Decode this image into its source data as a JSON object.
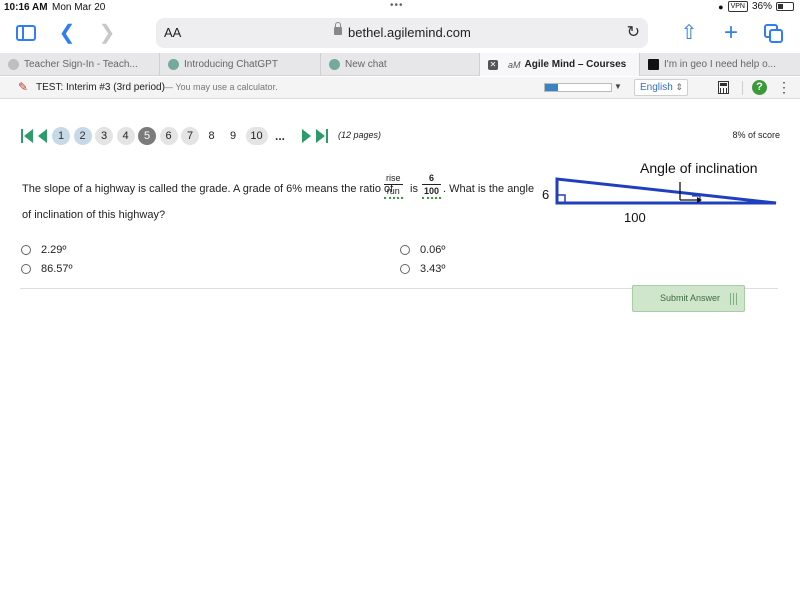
{
  "status": {
    "time": "10:16 AM",
    "date": "Mon Mar 20",
    "vpn": "VPN",
    "battery": "36%"
  },
  "browser": {
    "aa_label": "AA",
    "url": "bethel.agilemind.com",
    "accent_color": "#2f7ef5"
  },
  "tabs": [
    {
      "label": "Teacher Sign-In - Teach...",
      "icon": "teacher-favicon"
    },
    {
      "label": "Introducing ChatGPT",
      "icon": "chatgpt-favicon"
    },
    {
      "label": "New chat",
      "icon": "chatgpt-favicon"
    },
    {
      "label": "Agile Mind – Courses",
      "icon": "agilemind-favicon",
      "prefix": "aM",
      "active": true
    },
    {
      "label": "I'm in geo I need help o...",
      "icon": "bookmark-favicon"
    }
  ],
  "testbar": {
    "title": "TEST: Interim #3 (3rd period)",
    "note": "— You may use a calculator.",
    "progress_fraction": 0.2,
    "language": "English"
  },
  "pager": {
    "pages": [
      {
        "n": "1",
        "state": "answered"
      },
      {
        "n": "2",
        "state": "answered"
      },
      {
        "n": "3",
        "state": "visited"
      },
      {
        "n": "4",
        "state": "visited"
      },
      {
        "n": "5",
        "state": "current"
      },
      {
        "n": "6",
        "state": "visited"
      },
      {
        "n": "7",
        "state": "visited"
      },
      {
        "n": "8",
        "state": "plain"
      },
      {
        "n": "9",
        "state": "plain"
      },
      {
        "n": "10",
        "state": "visited"
      }
    ],
    "ellipsis": "...",
    "count": "(12 pages)",
    "score": "8% of score"
  },
  "question": {
    "part1": "The slope of a highway is called the grade. A grade of 6% means the ratio of",
    "frac1_num": "rise",
    "frac1_den": "run",
    "is_word": "is",
    "frac2_num": "6",
    "frac2_den": "100",
    "part2": ". What is the angle",
    "line2": "of inclination of this highway?"
  },
  "diagram": {
    "title": "Angle of inclination",
    "rise": "6",
    "run": "100"
  },
  "choices": [
    {
      "label": "2.29º"
    },
    {
      "label": "0.06º"
    },
    {
      "label": "86.57º"
    },
    {
      "label": "3.43º"
    }
  ],
  "submit_label": "Submit Answer"
}
